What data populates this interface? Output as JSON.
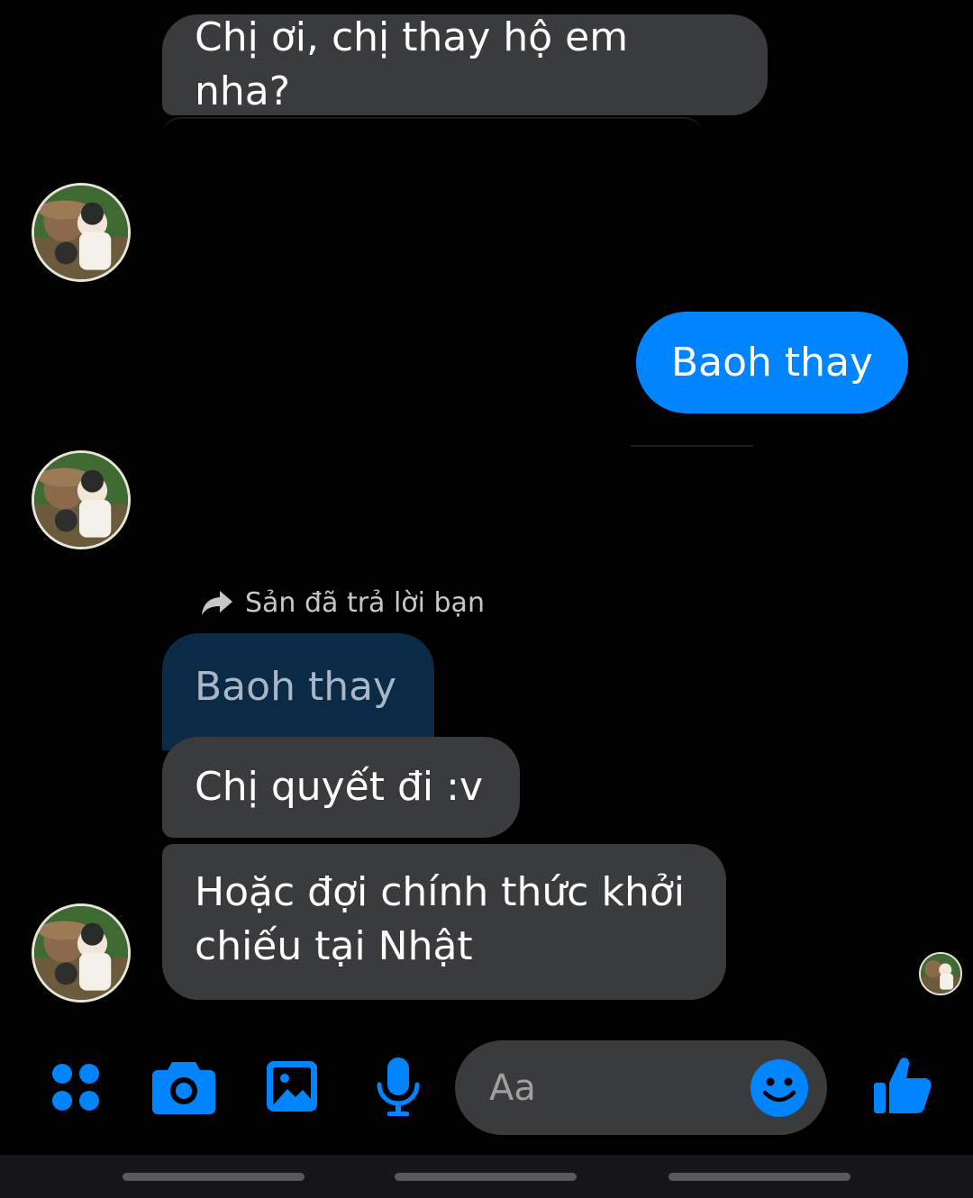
{
  "colors": {
    "background": "#000000",
    "received_bubble": "#3a3b3c",
    "sent_bubble": "#0084ff",
    "quoted_bubble": "#0b2a45",
    "accent": "#0084ff"
  },
  "messages": [
    {
      "type": "received",
      "text": "Chị ơi, chị thay hộ em nha?"
    },
    {
      "type": "sent",
      "text": "Baoh thay"
    },
    {
      "type": "received-quoted",
      "text": "Baoh thay"
    },
    {
      "type": "received",
      "text": "Chị quyết đi :v"
    },
    {
      "type": "received",
      "text": "Hoặc đợi chính thức khởi chiếu tại Nhật"
    }
  ],
  "reply_note": {
    "text": "Sản đã trả lời bạn",
    "icon": "reply-arrow-icon"
  },
  "composer": {
    "placeholder": "Aa",
    "icons": [
      "apps-grid-icon",
      "camera-icon",
      "image-icon",
      "microphone-icon",
      "emoji-icon",
      "thumbs-up-icon"
    ]
  }
}
